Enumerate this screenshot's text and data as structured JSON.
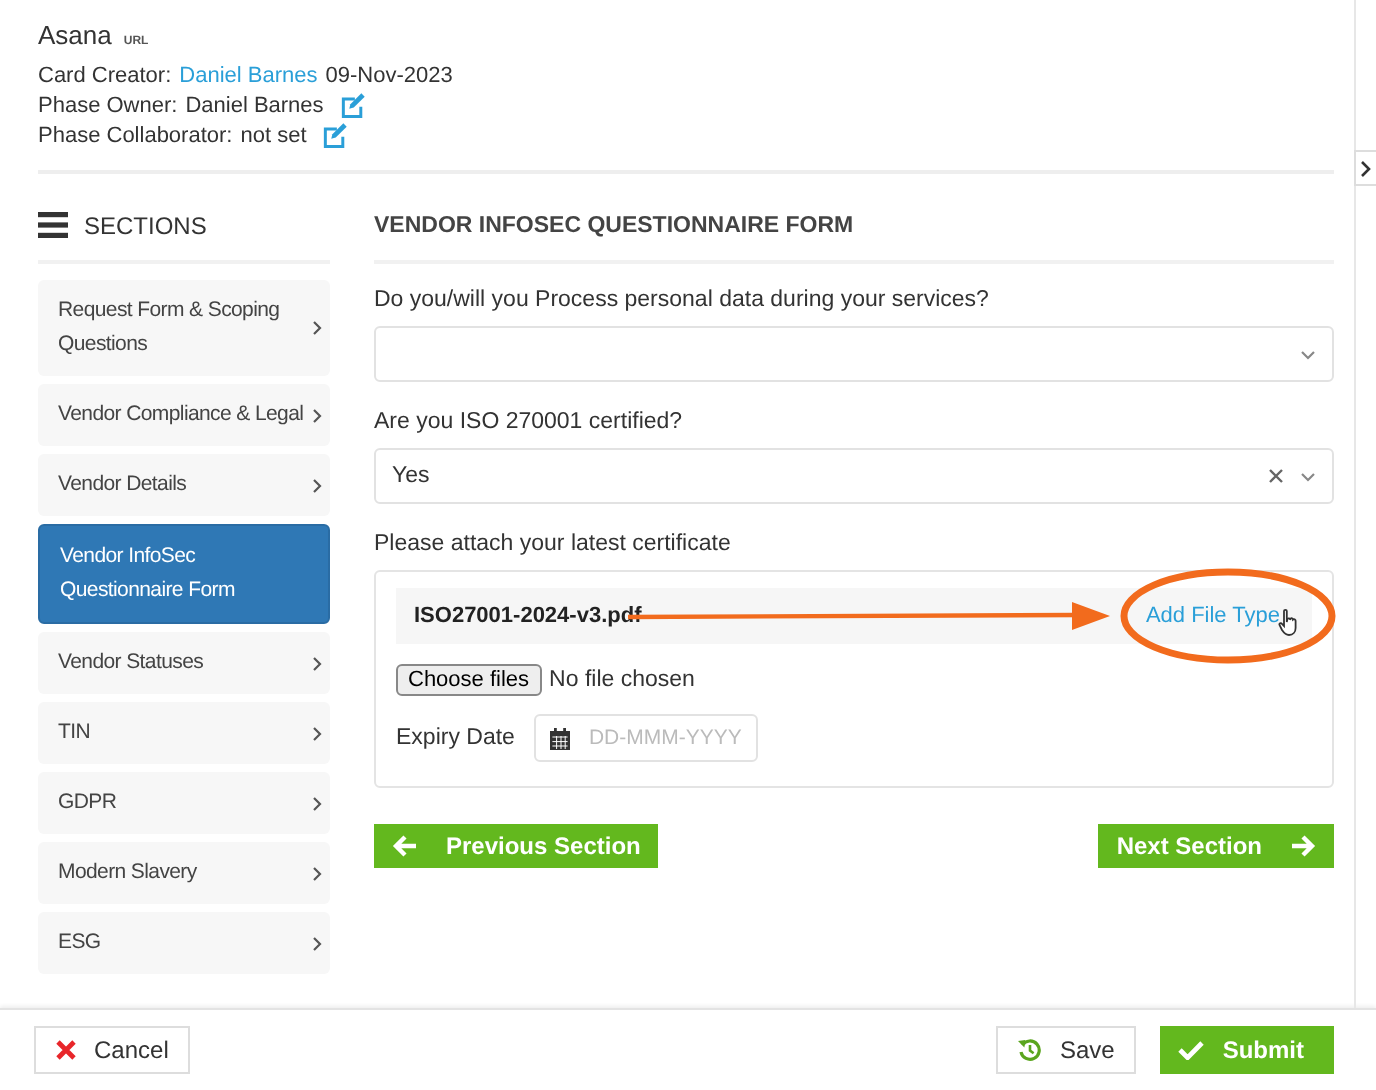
{
  "header": {
    "app_name": "Asana",
    "url_badge": "URL",
    "card_creator": {
      "label": "Card Creator:",
      "name": "Daniel Barnes",
      "date": "09-Nov-2023"
    },
    "phase_owner": {
      "label": "Phase Owner:",
      "value": "Daniel Barnes"
    },
    "phase_collaborator": {
      "label": "Phase Collaborator:",
      "value": "not set"
    }
  },
  "sidebar": {
    "title": "SECTIONS",
    "items": [
      {
        "label": "Request Form & Scoping Questions",
        "selected": false
      },
      {
        "label": "Vendor Compliance & Legal",
        "selected": false
      },
      {
        "label": "Vendor Details",
        "selected": false
      },
      {
        "label": "Vendor InfoSec Questionnaire Form",
        "selected": true
      },
      {
        "label": "Vendor Statuses",
        "selected": false
      },
      {
        "label": "TIN",
        "selected": false
      },
      {
        "label": "GDPR",
        "selected": false
      },
      {
        "label": "Modern Slavery",
        "selected": false
      },
      {
        "label": "ESG",
        "selected": false
      }
    ]
  },
  "form": {
    "title": "VENDOR INFOSEC QUESTIONNAIRE FORM",
    "questions": [
      {
        "label": "Do you/will you Process personal data during your services?",
        "clearable": false
      },
      {
        "label": "Are you ISO 270001 certified?",
        "value": "Yes",
        "clearable": true
      }
    ],
    "attachment": {
      "label": "Please attach your latest certificate",
      "file_name": "ISO27001-2024-v3.pdf",
      "link": "Add File Type",
      "choose_button": "Choose files",
      "no_file": "No file chosen",
      "expiry_label": "Expiry Date",
      "expiry_placeholder": "DD-MMM-YYYY"
    },
    "previous_button": "Previous Section",
    "next_button": "Next Section"
  },
  "footer": {
    "cancel": "Cancel",
    "save": "Save",
    "submit": "Submit"
  }
}
